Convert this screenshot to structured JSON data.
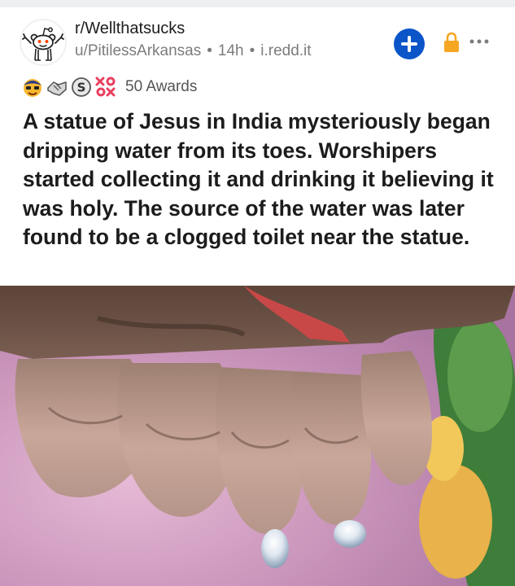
{
  "post": {
    "subreddit": "r/Wellthatsucks",
    "author": "u/PitilessArkansas",
    "age": "14h",
    "domain": "i.redd.it",
    "awards_text": "50 Awards",
    "title": "A statue of Jesus in India mysteriously began dripping water from its toes. Worshipers started collecting it and drinking it believing it was holy. The source of the water was later found to be a clogged toilet near the statue."
  },
  "colors": {
    "join_button": "#0c55c8",
    "lock": "#f5a623",
    "meta_text": "#7c7c7c",
    "title_text": "#1c1c1c"
  },
  "icons": [
    "snoo-avatar-icon",
    "plus-icon",
    "lock-icon",
    "more-icon",
    "award-icons"
  ]
}
